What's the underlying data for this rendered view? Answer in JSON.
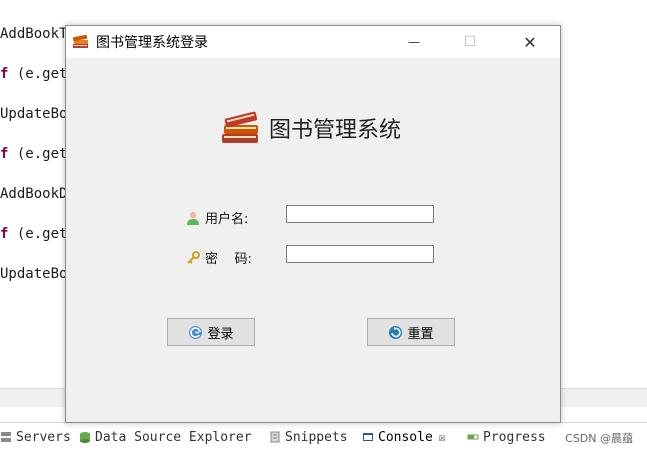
{
  "editor": {
    "lines": [
      {
        "pre": "",
        "kw": "",
        "text": "AddBookT"
      },
      {
        "pre": "",
        "kw": "f",
        "text": " (e.get"
      },
      {
        "pre": "",
        "kw": "",
        "text": "UpdateBo"
      },
      {
        "pre": "",
        "kw": "f",
        "text": " (e.get"
      },
      {
        "pre": "",
        "kw": "",
        "text": "AddBookD"
      },
      {
        "pre": "",
        "kw": "f",
        "text": " (e.get"
      },
      {
        "pre": "",
        "kw": "",
        "text": "UpdateBo"
      }
    ]
  },
  "bottom_tabs": [
    {
      "label": "Servers",
      "icon": "servers-icon"
    },
    {
      "label": "Data Source Explorer",
      "icon": "database-icon"
    },
    {
      "label": "Snippets",
      "icon": "snippets-icon"
    },
    {
      "label": "Console",
      "icon": "console-icon",
      "active": true,
      "close": "☒"
    },
    {
      "label": "Progress",
      "icon": "progress-icon"
    }
  ],
  "watermark": "CSDN @晨蕴",
  "window": {
    "title": "图书管理系统登录",
    "heading": "图书管理系统",
    "username_label": "用户名:",
    "password_label": "密    码:",
    "username_value": "",
    "password_value": "",
    "login_label": "登录",
    "reset_label": "重置",
    "minimize_symbol": "—",
    "maximize_symbol": "☐",
    "close_symbol": "✕"
  }
}
